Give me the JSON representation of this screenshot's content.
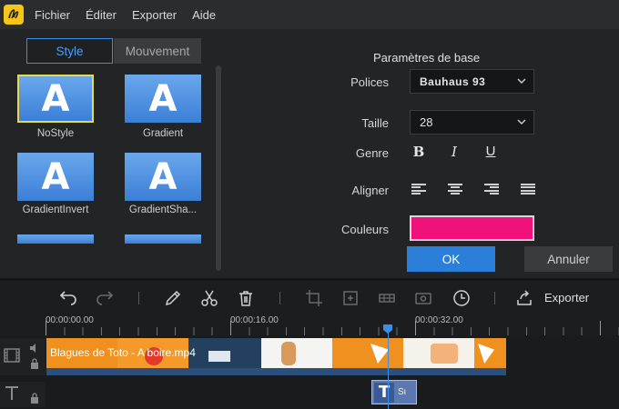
{
  "menu": {
    "items": [
      "Fichier",
      "Éditer",
      "Exporter",
      "Aide"
    ]
  },
  "tabs": {
    "style": "Style",
    "mouvement": "Mouvement"
  },
  "styles": {
    "glyph": "A",
    "items": [
      {
        "label": "NoStyle",
        "selected": true
      },
      {
        "label": "Gradient",
        "selected": false
      },
      {
        "label": "GradientInvert",
        "selected": false
      },
      {
        "label": "GradientSha...",
        "selected": false
      }
    ]
  },
  "params": {
    "title": "Paramètres de base",
    "font_label": "Polices",
    "font_value": "Bauhaus 93",
    "size_label": "Taille",
    "size_value": "28",
    "genre_label": "Genre",
    "bold": "B",
    "italic": "I",
    "underline": "U",
    "align_label": "Aligner",
    "color_label": "Couleurs",
    "color_value": "#f0127a"
  },
  "buttons": {
    "ok": "OK",
    "cancel": "Annuler"
  },
  "toolbar": {
    "export_label": "Exporter"
  },
  "timeline": {
    "time_labels": [
      "00:00:00.00",
      "00:00:16.00",
      "00:00:32.00"
    ],
    "video_clip_title": "Blagues de Toto - A boire.mp4",
    "text_clip_glyph": "T",
    "text_clip_name": "Sι"
  },
  "colors": {
    "accent": "#3b8ee6",
    "clip": "#ee8a20",
    "swatch": "#f0127a"
  }
}
